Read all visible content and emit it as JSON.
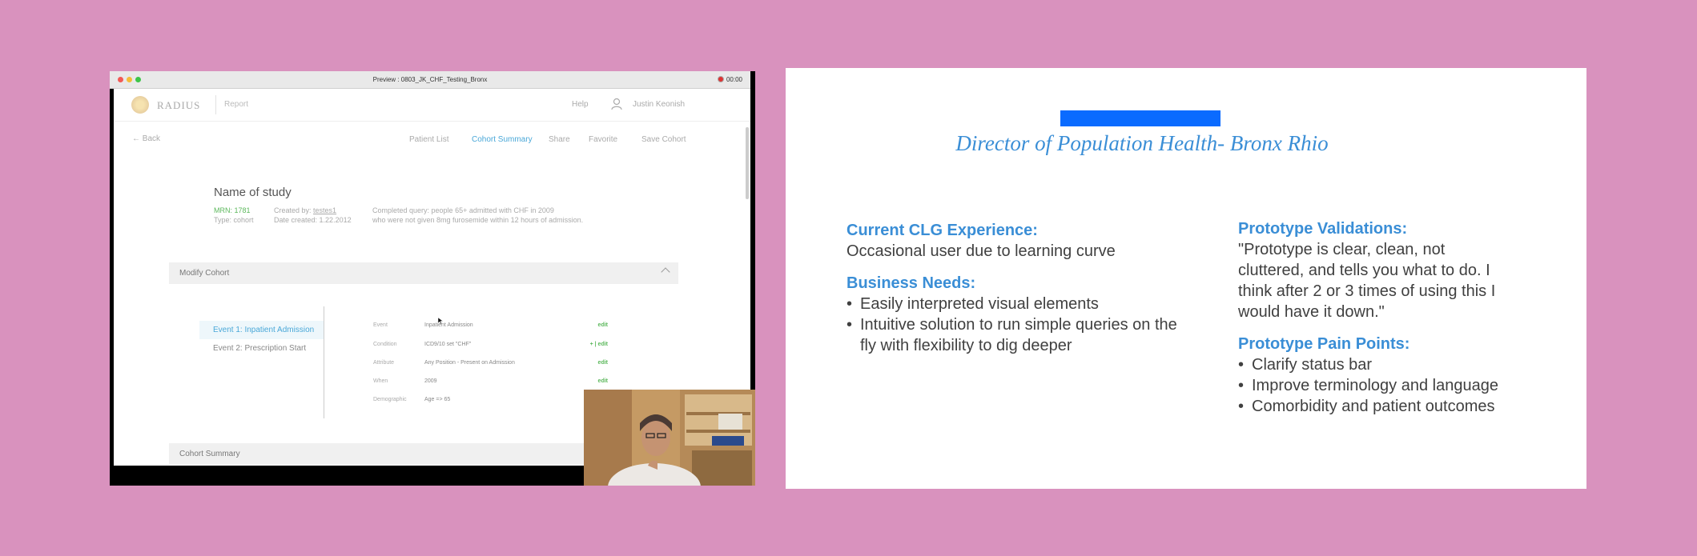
{
  "recording": {
    "window_title": "Preview : 0803_JK_CHF_Testing_Bronx",
    "timer": "00:00",
    "app": {
      "logo": "RADIUS",
      "section": "Report",
      "help": "Help",
      "user": "Justin Keonish",
      "back": "Back",
      "nav": [
        "Patient List",
        "Cohort Summary",
        "Share",
        "Favorite",
        "Save Cohort"
      ],
      "active_nav": "Cohort Summary",
      "study": {
        "title": "Name of study",
        "mrn_label": "MRN:",
        "mrn": "1781",
        "type_label": "Type:",
        "type": "cohort",
        "created_by_label": "Created by:",
        "created_by": "testes1",
        "date_created_label": "Date created:",
        "date_created": "1.22.2012",
        "query_line1": "Completed query:  people 65+ admitted with CHF in 2009",
        "query_line2": "who were not given 8mg furosemide within 12 hours of admission."
      },
      "modify_cohort": "Modify Cohort",
      "events": [
        "Event 1: Inpatient Admission",
        "Event 2: Prescription Start"
      ],
      "criteria": [
        {
          "key": "Event",
          "value": "Inpatient Admission",
          "action": "edit"
        },
        {
          "key": "Condition",
          "value": "ICD9/10 set \"CHF\"",
          "action": "+ | edit"
        },
        {
          "key": "Attribute",
          "value": "Any Position - Present on Admission",
          "action": "edit"
        },
        {
          "key": "When",
          "value": "2009",
          "action": "edit"
        },
        {
          "key": "Demographic",
          "value": "Age => 65",
          "action": ""
        }
      ],
      "cohort_summary": "Cohort Summary"
    }
  },
  "slide": {
    "role": "Director of Population Health- Bronx Rhio",
    "current_h": "Current CLG Experience:",
    "current": "Occasional user due to learning curve",
    "needs_h": "Business Needs:",
    "needs": [
      "Easily interpreted visual elements",
      "Intuitive solution to run simple queries on the fly with flexibility to dig deeper"
    ],
    "validations_h": "Prototype Validations:",
    "validations": "\"Prototype is clear, clean, not cluttered, and tells you what to do. I think after 2 or 3 times of using this I would have it down.\"",
    "pain_h": "Prototype Pain Points:",
    "pain": [
      "Clarify status bar",
      "Improve terminology and language",
      "Comorbidity and patient outcomes"
    ]
  },
  "colors": {
    "background": "#d992be",
    "accent": "#3a8ed6",
    "app_link": "#4aa8d8",
    "edit_green": "#5cb85c",
    "redaction": "#0a6bff"
  }
}
